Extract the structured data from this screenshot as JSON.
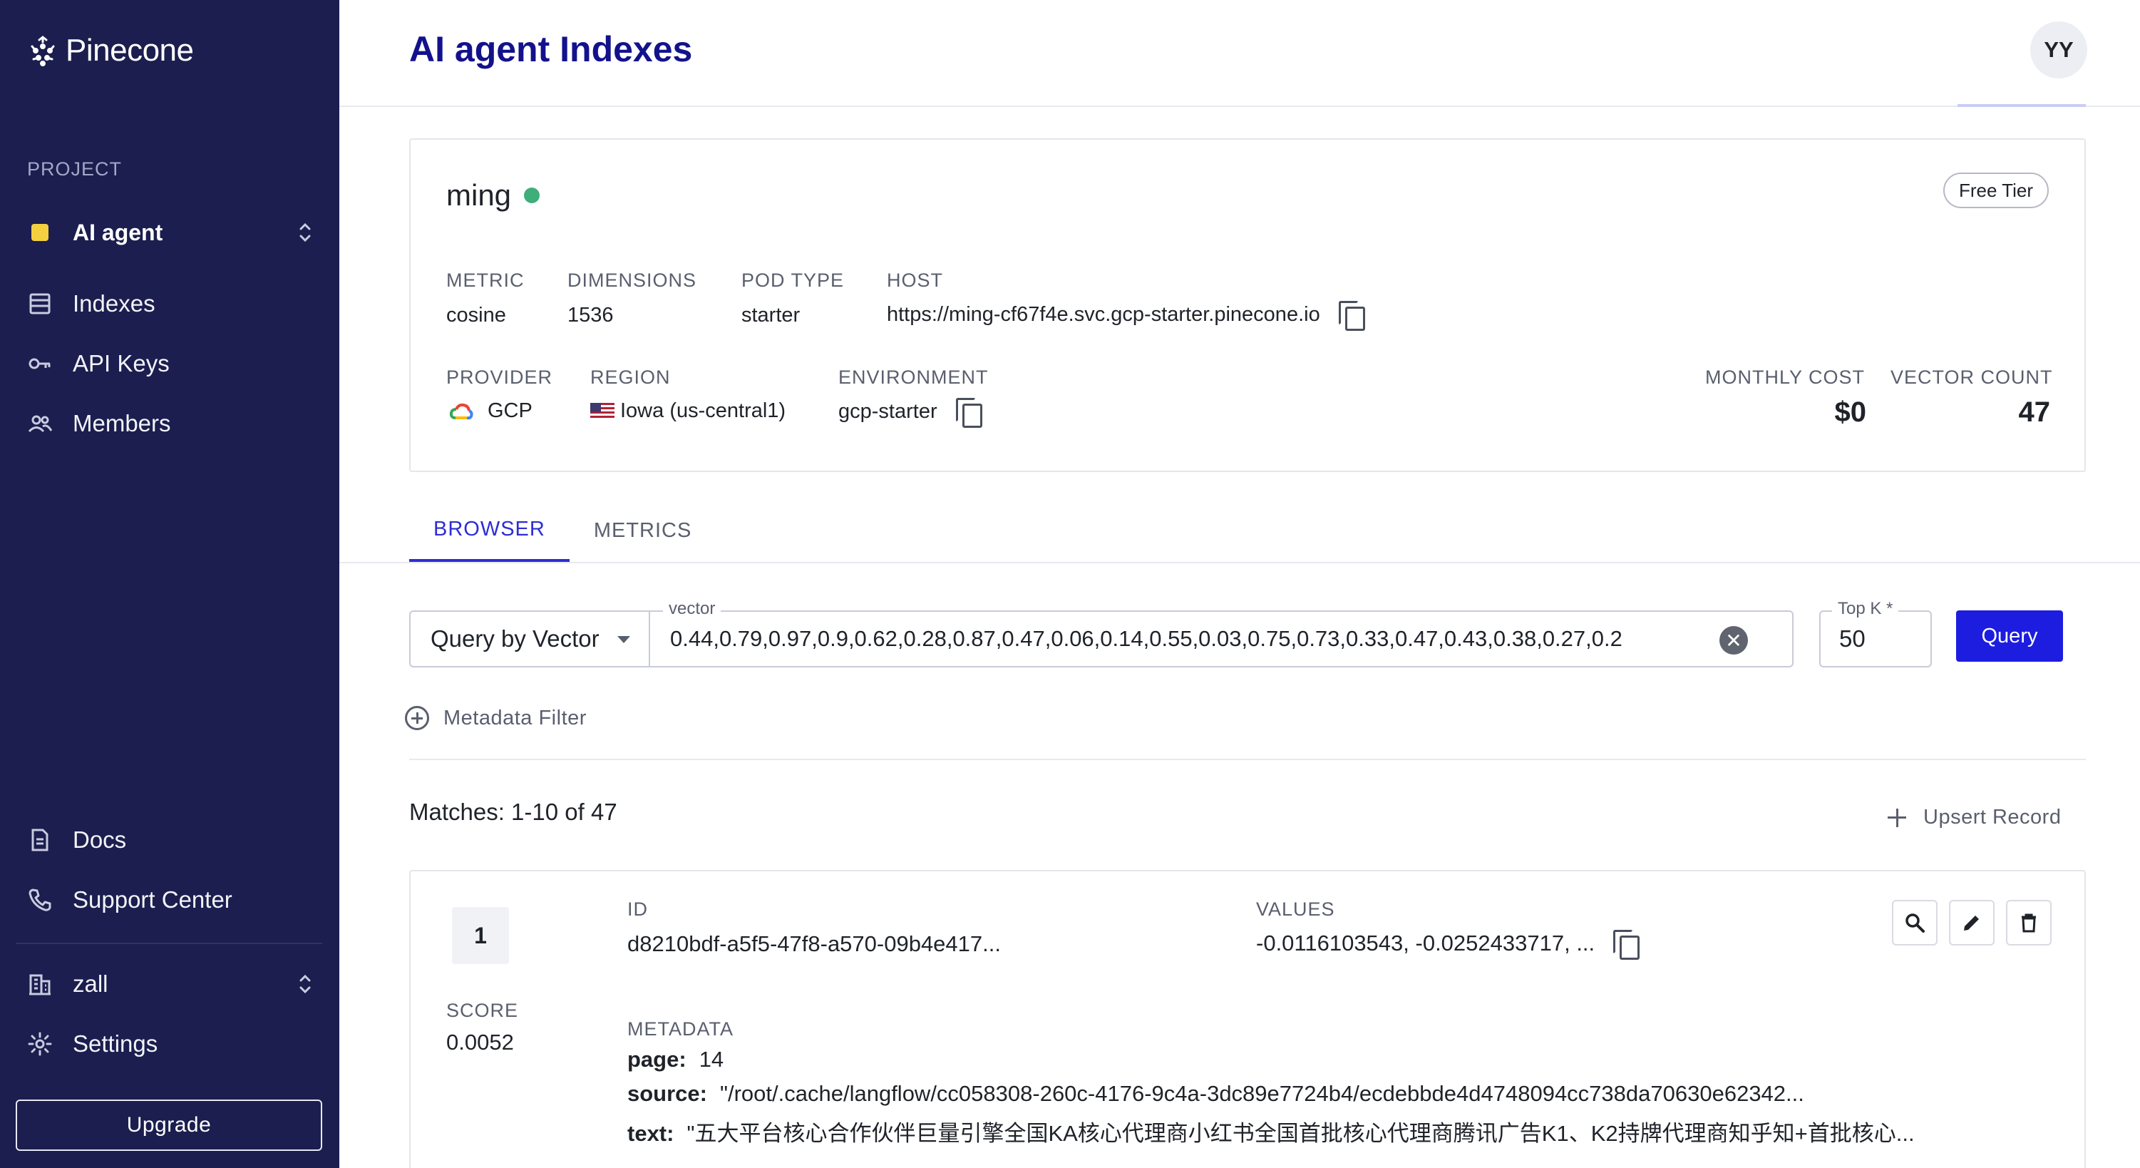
{
  "sidebar": {
    "brand": "Pinecone",
    "project_label": "PROJECT",
    "project_name": "AI agent",
    "nav": [
      {
        "label": "Indexes",
        "icon": "table-icon"
      },
      {
        "label": "API Keys",
        "icon": "key-icon"
      },
      {
        "label": "Members",
        "icon": "members-icon"
      }
    ],
    "bottom_nav": [
      {
        "label": "Docs",
        "icon": "document-icon"
      },
      {
        "label": "Support Center",
        "icon": "phone-icon"
      }
    ],
    "org_name": "zall",
    "settings_label": "Settings",
    "upgrade_label": "Upgrade",
    "accent": "#f4d03f",
    "bg": "#1b1e4e"
  },
  "header": {
    "title": "AI agent Indexes",
    "avatar_initials": "YY"
  },
  "index": {
    "name": "ming",
    "status_color": "#3fae7b",
    "tier": "Free Tier",
    "metric_label": "METRIC",
    "metric": "cosine",
    "dimensions_label": "DIMENSIONS",
    "dimensions": "1536",
    "pod_type_label": "POD TYPE",
    "pod_type": "starter",
    "host_label": "HOST",
    "host": "https://ming-cf67f4e.svc.gcp-starter.pinecone.io",
    "provider_label": "PROVIDER",
    "provider": "GCP",
    "region_label": "REGION",
    "region": "Iowa (us-central1)",
    "environment_label": "ENVIRONMENT",
    "environment": "gcp-starter",
    "monthly_cost_label": "MONTHLY COST",
    "monthly_cost": "$0",
    "vector_count_label": "VECTOR COUNT",
    "vector_count": "47"
  },
  "tabs": [
    {
      "label": "BROWSER",
      "active": true
    },
    {
      "label": "METRICS",
      "active": false
    }
  ],
  "query": {
    "mode": "Query by Vector",
    "vector_label": "vector",
    "vector_value": "0.44,0.79,0.97,0.9,0.62,0.28,0.87,0.47,0.06,0.14,0.55,0.03,0.75,0.73,0.33,0.47,0.43,0.38,0.27,0.2",
    "topk_label": "Top K *",
    "topk_value": "50",
    "query_button": "Query",
    "accent": "#1d1de0"
  },
  "metadata_filter_label": "Metadata Filter",
  "matches_text": "Matches: 1-10 of 47",
  "upsert_label": "Upsert Record",
  "results": [
    {
      "rank": "1",
      "score_label": "SCORE",
      "score": "0.0052",
      "id_label": "ID",
      "id": "d8210bdf-a5f5-47f8-a570-09b4e417...",
      "values_label": "VALUES",
      "values": "-0.0116103543, -0.0252433717, ...",
      "metadata_label": "METADATA",
      "metadata": [
        {
          "key": "page:",
          "value": "14"
        },
        {
          "key": "source:",
          "value": "\"/root/.cache/langflow/cc058308-260c-4176-9c4a-3dc89e7724b4/ecdebbde4d4748094cc738da70630e62342..."
        },
        {
          "key": "text:",
          "value": "\"五大平台核心合作伙伴巨量引擎全国KA核心代理商小红书全国首批核心代理商腾讯广告K1、K2持牌代理商知乎知+首批核心..."
        }
      ]
    }
  ]
}
